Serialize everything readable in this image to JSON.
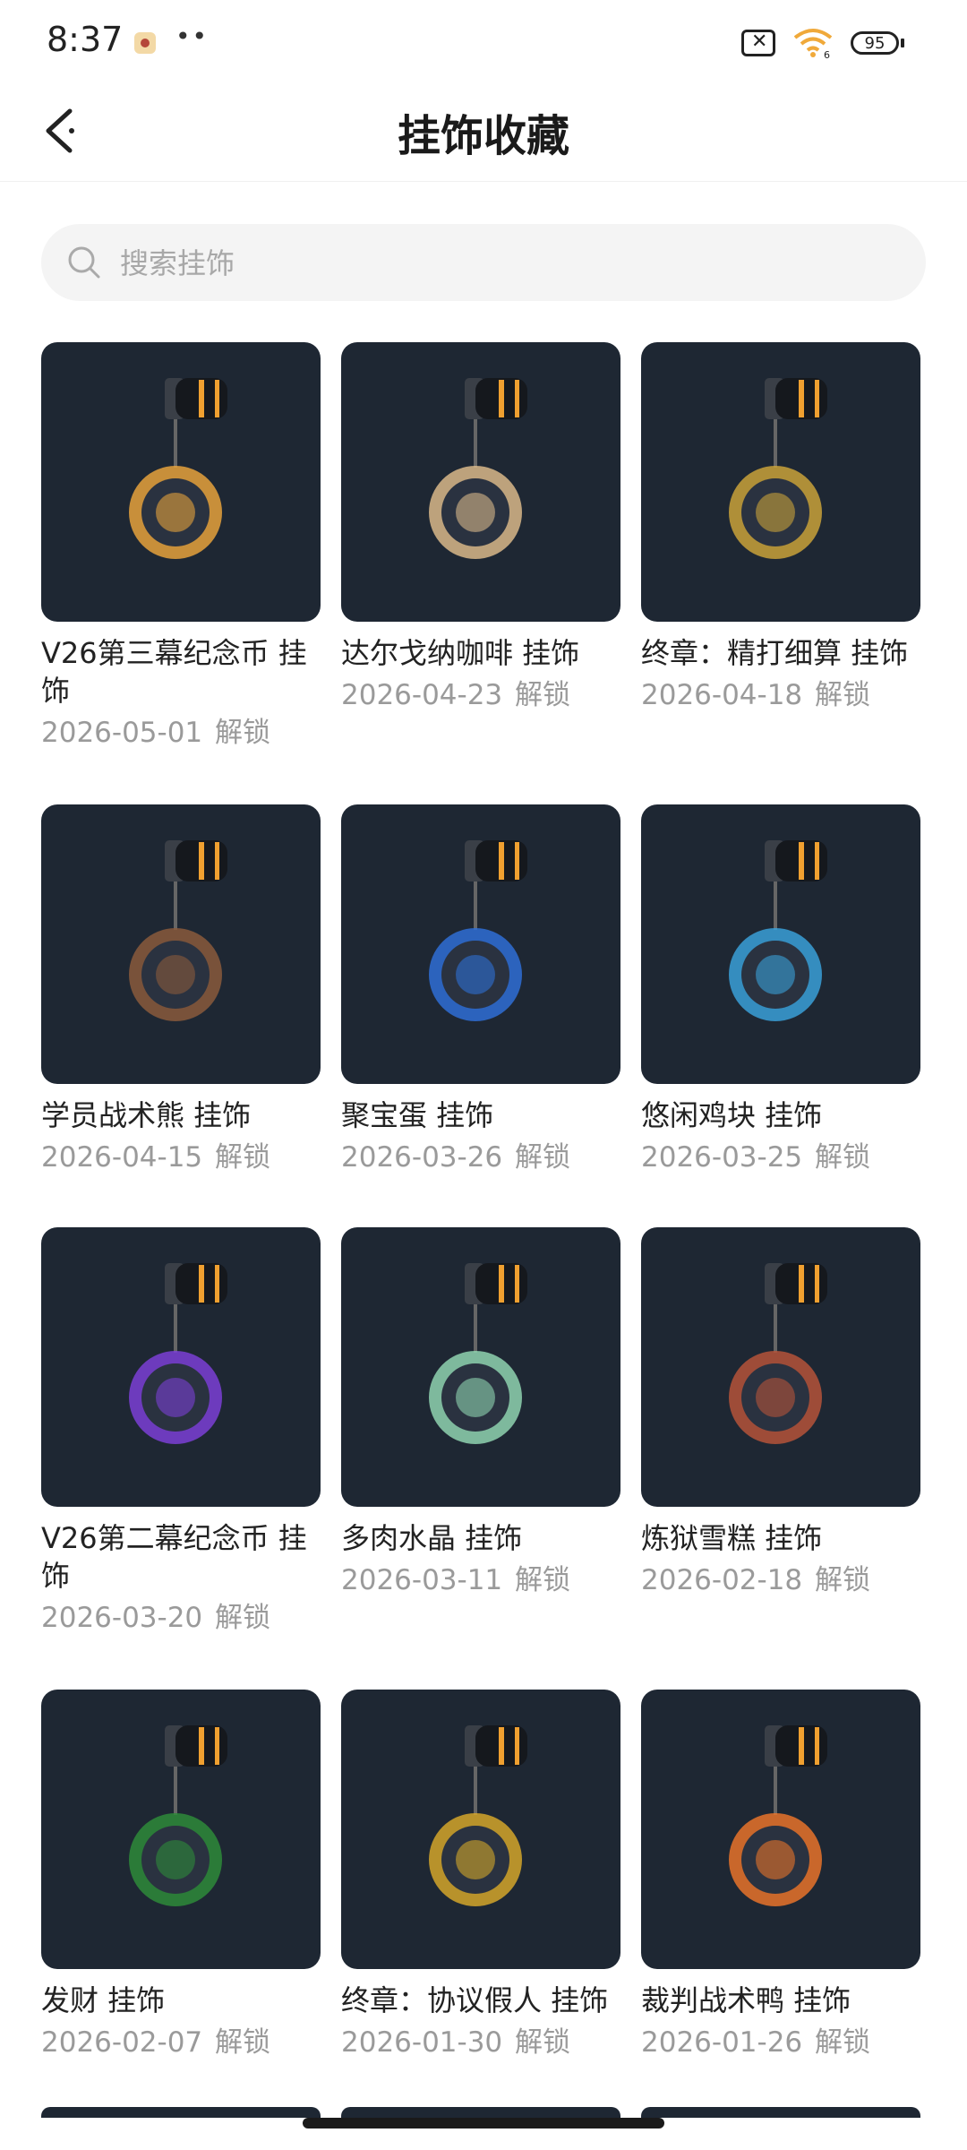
{
  "status": {
    "time": "8:37",
    "battery": "95",
    "signal_label": "6"
  },
  "header": {
    "title": "挂饰收藏"
  },
  "search": {
    "placeholder": "搜索挂饰"
  },
  "unlock_suffix": "解锁",
  "items": [
    {
      "name": "V26第三幕纪念币 挂饰",
      "date": "2026-05-01",
      "icon": "coin-charm-icon",
      "accent": "#e6a23c"
    },
    {
      "name": "达尔戈纳咖啡 挂饰",
      "date": "2026-04-23",
      "icon": "coffee-cup-charm-icon",
      "accent": "#d9b88a"
    },
    {
      "name": "终章：精打细算 挂饰",
      "date": "2026-04-18",
      "icon": "golden-pig-charm-icon",
      "accent": "#c9a23a"
    },
    {
      "name": "学员战术熊 挂饰",
      "date": "2026-04-15",
      "icon": "bear-charm-icon",
      "accent": "#8a5a3c"
    },
    {
      "name": "聚宝蛋 挂饰",
      "date": "2026-03-26",
      "icon": "egg-charm-icon",
      "accent": "#2f6fd6"
    },
    {
      "name": "悠闲鸡块 挂饰",
      "date": "2026-03-25",
      "icon": "nugget-charm-icon",
      "accent": "#3aa0d8"
    },
    {
      "name": "V26第二幕纪念币 挂饰",
      "date": "2026-03-20",
      "icon": "coin-charm-icon",
      "accent": "#7b3fd6"
    },
    {
      "name": "多肉水晶 挂饰",
      "date": "2026-03-11",
      "icon": "crystal-terrarium-charm-icon",
      "accent": "#8fd3b0"
    },
    {
      "name": "炼狱雪糕 挂饰",
      "date": "2026-02-18",
      "icon": "popsicle-charm-icon",
      "accent": "#b5543a"
    },
    {
      "name": "发财 挂饰",
      "date": "2026-02-07",
      "icon": "mahjong-tile-charm-icon",
      "accent": "#2e8b3a"
    },
    {
      "name": "终章：协议假人 挂饰",
      "date": "2026-01-30",
      "icon": "gold-dummy-charm-icon",
      "accent": "#d4a62a"
    },
    {
      "name": "裁判战术鸭 挂饰",
      "date": "2026-01-26",
      "icon": "referee-duck-charm-icon",
      "accent": "#e8732a"
    }
  ]
}
